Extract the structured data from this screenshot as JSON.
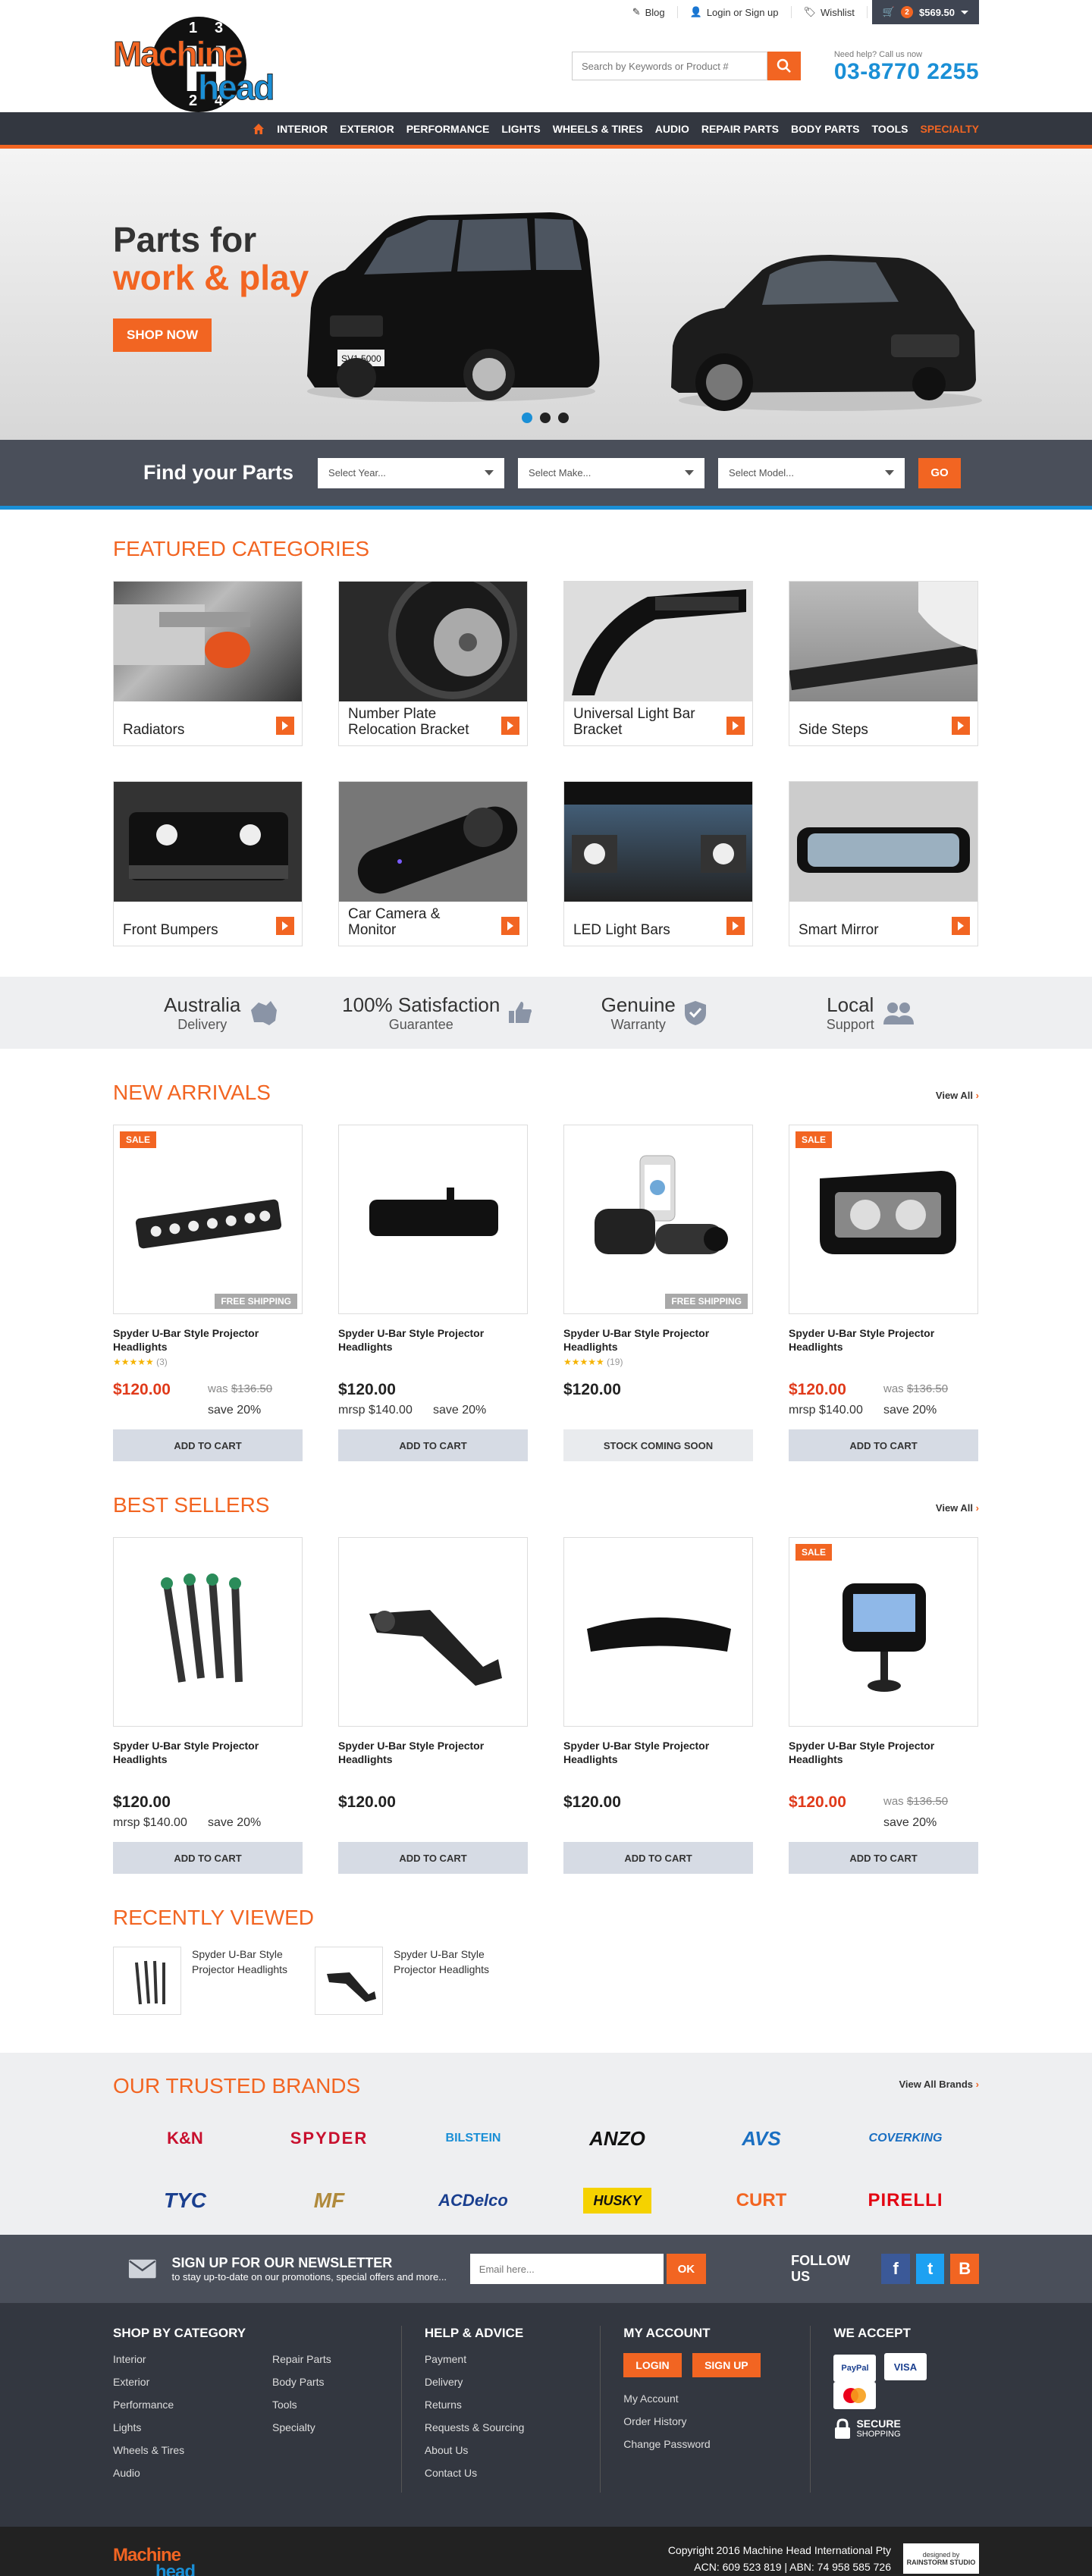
{
  "brand": {
    "logo_top": "Machine",
    "logo_bottom": "head",
    "logo_center": "H",
    "logo_nums": [
      "1",
      "3",
      "2",
      "4"
    ],
    "accent": "#f26522",
    "secondary": "#1a8fd6",
    "dark": "#333740"
  },
  "topbar": {
    "blog": "Blog",
    "login": "Login or Sign up",
    "wishlist": "Wishlist",
    "cart_count": "2",
    "cart_total": "$569.50"
  },
  "search": {
    "placeholder": "Search by Keywords or Product #"
  },
  "phone": {
    "label": "Need help? Call us now",
    "number": "03-8770 2255"
  },
  "nav": [
    "INTERIOR",
    "EXTERIOR",
    "PERFORMANCE",
    "LIGHTS",
    "WHEELS & TIRES",
    "AUDIO",
    "REPAIR PARTS",
    "BODY PARTS",
    "TOOLS",
    "SPECIALTY"
  ],
  "hero": {
    "line1": "Parts for",
    "line2": "work & play",
    "button": "SHOP NOW",
    "plate": "SV1 5000"
  },
  "finder": {
    "title": "Find your Parts",
    "year": "Select Year...",
    "make": "Select Make...",
    "model": "Select Model...",
    "go": "GO"
  },
  "featured": {
    "title": "FEATURED CATEGORIES",
    "items": [
      {
        "label": "Radiators",
        "icon": "radiator-image"
      },
      {
        "label": "Number Plate Relocation Bracket",
        "icon": "tyre-image"
      },
      {
        "label": "Universal Light Bar Bracket",
        "icon": "light-bar-image"
      },
      {
        "label": "Side Steps",
        "icon": "side-step-image"
      },
      {
        "label": "Front Bumpers",
        "icon": "jeep-bumper-image"
      },
      {
        "label": "Car Camera & Monitor",
        "icon": "camera-image"
      },
      {
        "label": "LED Light Bars",
        "icon": "led-bar-image"
      },
      {
        "label": "Smart Mirror",
        "icon": "mirror-image"
      }
    ]
  },
  "usp": [
    {
      "a": "Australia",
      "b": "Delivery",
      "icon": "australia-map-icon"
    },
    {
      "a": "100% Satisfaction",
      "b": "Guarantee",
      "icon": "thumbs-up-icon"
    },
    {
      "a": "Genuine",
      "b": "Warranty",
      "icon": "shield-check-icon"
    },
    {
      "a": "Local",
      "b": "Support",
      "icon": "people-icon"
    }
  ],
  "new_arrivals": {
    "title": "NEW ARRIVALS",
    "view_all": "View All",
    "items": [
      {
        "name": "Spyder U-Bar Style Projector Headlights",
        "sale": "SALE",
        "free": "FREE SHIPPING",
        "stars": "★★★★★",
        "reviews": "(3)",
        "price": "$120.00",
        "was_label": "was",
        "was": "$136.50",
        "mrsp": "",
        "save": "save 20%",
        "button": "ADD TO CART",
        "red": true,
        "image": "led-light-bar"
      },
      {
        "name": "Spyder U-Bar Style Projector Headlights",
        "sale": "",
        "free": "",
        "stars": "",
        "reviews": "",
        "price": "$120.00",
        "was_label": "",
        "was": "",
        "mrsp": "mrsp $140.00",
        "save": "save 20%",
        "button": "ADD TO CART",
        "red": false,
        "image": "third-brake-light"
      },
      {
        "name": "Spyder U-Bar Style Projector Headlights",
        "sale": "",
        "free": "FREE SHIPPING",
        "stars": "★★★★★",
        "reviews": "(19)",
        "price": "$120.00",
        "was_label": "",
        "was": "",
        "mrsp": "",
        "save": "",
        "button": "STOCK COMING SOON",
        "red": false,
        "image": "dash-camera"
      },
      {
        "name": "Spyder U-Bar Style Projector Headlights",
        "sale": "SALE",
        "free": "",
        "stars": "",
        "reviews": "",
        "price": "$120.00",
        "was_label": "was",
        "was": "$136.50",
        "mrsp": "mrsp $140.00",
        "save": "save 20%",
        "button": "ADD TO CART",
        "red": true,
        "image": "work-light"
      }
    ]
  },
  "best_sellers": {
    "title": "BEST SELLERS",
    "view_all": "View All",
    "items": [
      {
        "name": "Spyder U-Bar Style Projector Headlights",
        "sale": "",
        "price": "$120.00",
        "was_label": "",
        "was": "",
        "mrsp": "mrsp $140.00",
        "save": "save 20%",
        "button": "ADD TO CART",
        "red": false,
        "image": "injectors"
      },
      {
        "name": "Spyder U-Bar Style Projector Headlights",
        "sale": "",
        "price": "$120.00",
        "was_label": "",
        "was": "",
        "mrsp": "",
        "save": "",
        "button": "ADD TO CART",
        "red": false,
        "image": "control-arm"
      },
      {
        "name": "Spyder U-Bar Style Projector Headlights",
        "sale": "",
        "price": "$120.00",
        "was_label": "",
        "was": "",
        "mrsp": "",
        "save": "",
        "button": "ADD TO CART",
        "red": false,
        "image": "bonnet-protector"
      },
      {
        "name": "Spyder U-Bar Style Projector Headlights",
        "sale": "SALE",
        "price": "$120.00",
        "was_label": "was",
        "was": "$136.50",
        "mrsp": "",
        "save": "save 20%",
        "button": "ADD TO CART",
        "red": true,
        "image": "gauge-display"
      }
    ]
  },
  "recent": {
    "title": "RECENTLY VIEWED",
    "items": [
      {
        "name": "Spyder U-Bar Style Projector Headlights"
      },
      {
        "name": "Spyder U-Bar Style Projector Headlights"
      }
    ]
  },
  "brands": {
    "title": "OUR TRUSTED BRANDS",
    "view_all": "View All Brands",
    "items": [
      {
        "name": "K&N",
        "color": "#c8102e"
      },
      {
        "name": "SPYDER",
        "color": "#c8102e"
      },
      {
        "name": "BILSTEIN",
        "color": "#1a8fd6"
      },
      {
        "name": "ANZO",
        "color": "#111111"
      },
      {
        "name": "AVS",
        "color": "#1a6fc2"
      },
      {
        "name": "COVERKING",
        "color": "#1a6fc2"
      },
      {
        "name": "TYC",
        "color": "#1a3f8f"
      },
      {
        "name": "MF",
        "color": "#b08a3c"
      },
      {
        "name": "ACDelco",
        "color": "#1a3f8f"
      },
      {
        "name": "HUSKY",
        "color": "#111111"
      },
      {
        "name": "CURT",
        "color": "#f26522"
      },
      {
        "name": "PIRELLI",
        "color": "#e30613"
      }
    ]
  },
  "newsletter": {
    "title": "SIGN UP FOR OUR NEWSLETTER",
    "sub": "to stay up-to-date on our promotions, special offers and more...",
    "placeholder": "Email here...",
    "ok": "OK",
    "follow": "FOLLOW US"
  },
  "footer": {
    "shop_title": "SHOP BY CATEGORY",
    "shop_col1": [
      "Interior",
      "Exterior",
      "Performance",
      "Lights",
      "Wheels & Tires",
      "Audio"
    ],
    "shop_col2": [
      "Repair Parts",
      "Body Parts",
      "Tools",
      "Specialty"
    ],
    "help_title": "HELP & ADVICE",
    "help": [
      "Payment",
      "Delivery",
      "Returns",
      "Requests & Sourcing",
      "About Us",
      "Contact Us"
    ],
    "account_title": "MY ACCOUNT",
    "login": "LOGIN",
    "signup": "SIGN UP",
    "account": [
      "My Account",
      "Order History",
      "Change Password"
    ],
    "accept_title": "WE ACCEPT",
    "cards": [
      "PayPal",
      "VISA",
      "MC"
    ],
    "secure": "SECURE",
    "secure_sub": "SHOPPING"
  },
  "bottom": {
    "copy1": "Copyright 2016 Machine Head International Pty",
    "copy2": "ACN: 609 523 819 | ABN: 74 958 585 726",
    "designed_by": "designed by",
    "studio": "RAINSTORM STUDIO"
  }
}
